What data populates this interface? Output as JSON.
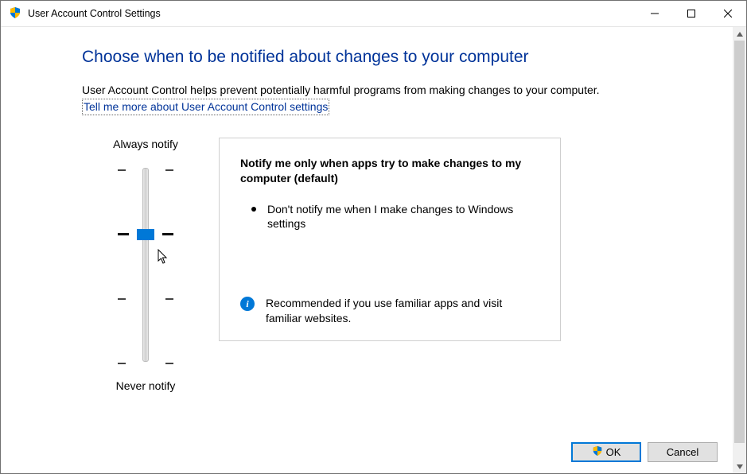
{
  "window": {
    "title": "User Account Control Settings"
  },
  "heading": "Choose when to be notified about changes to your computer",
  "description": "User Account Control helps prevent potentially harmful programs from making changes to your computer.",
  "link_text": "Tell me more about User Account Control settings",
  "slider": {
    "top_label": "Always notify",
    "bottom_label": "Never notify",
    "levels": 4,
    "selected_index": 1
  },
  "panel": {
    "title": "Notify me only when apps try to make changes to my computer (default)",
    "bullet": "Don't notify me when I make changes to Windows settings",
    "recommendation": "Recommended if you use familiar apps and visit familiar websites."
  },
  "buttons": {
    "ok": "OK",
    "cancel": "Cancel"
  }
}
